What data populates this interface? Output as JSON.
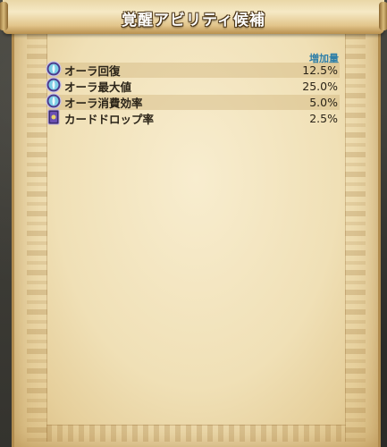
{
  "panel": {
    "title": "覚醒アビリティ候補",
    "column_header": "増加量"
  },
  "abilities": [
    {
      "icon": "aura-orb-icon",
      "name": "オーラ回復",
      "value": "12.5%"
    },
    {
      "icon": "aura-orb-icon",
      "name": "オーラ最大値",
      "value": "25.0%"
    },
    {
      "icon": "aura-orb-icon",
      "name": "オーラ消費効率",
      "value": "5.0%"
    },
    {
      "icon": "card-icon",
      "name": "カードドロップ率",
      "value": "2.5%"
    }
  ],
  "colors": {
    "header_text": "#2f7fa8",
    "row_text": "#2b2418",
    "row_shade": "#d8c08a"
  }
}
